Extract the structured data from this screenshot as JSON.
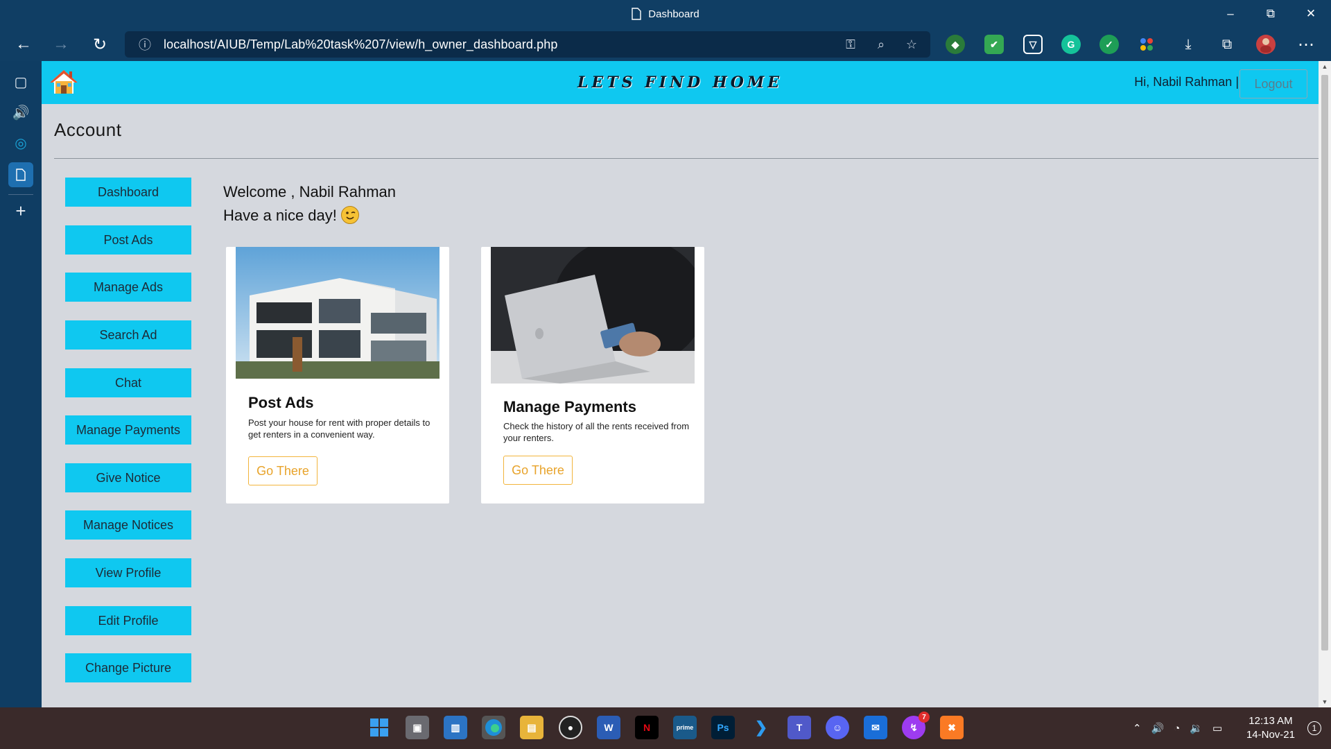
{
  "window": {
    "title": "Dashboard",
    "minimize_icon": "minimize-icon",
    "restore_icon": "restore-icon",
    "close_icon": "close-icon"
  },
  "browser": {
    "url": "localhost/AIUB/Temp/Lab%20task%207/view/h_owner_dashboard.php",
    "buttons": [
      "back",
      "forward",
      "refresh"
    ],
    "extension_icons": [
      "chrome-ext-icon",
      "shield-green-icon",
      "brave-shield-icon",
      "grammarly-icon",
      "check-shield-icon",
      "google-dots-icon"
    ]
  },
  "app": {
    "brand": "LETS FIND HOME",
    "greeting": "Hi, Nabil Rahman |",
    "logout": "Logout",
    "page_title": "Account",
    "accent_color": "#0fc8f0",
    "welcome_line1": "Welcome , Nabil Rahman",
    "welcome_line2": "Have a nice day!",
    "sidebar": [
      {
        "label": "Dashboard"
      },
      {
        "label": "Post Ads"
      },
      {
        "label": "Manage Ads"
      },
      {
        "label": "Search Ad"
      },
      {
        "label": "Chat"
      },
      {
        "label": "Manage Payments"
      },
      {
        "label": "Give Notice"
      },
      {
        "label": "Manage Notices"
      },
      {
        "label": "View Profile"
      },
      {
        "label": "Edit Profile"
      },
      {
        "label": "Change Picture"
      }
    ],
    "cards": [
      {
        "title": "Post Ads",
        "desc": "Post your house for rent with proper details to get renters in a convenient way.",
        "button": "Go There"
      },
      {
        "title": "Manage Payments",
        "desc": "Check the history of all the rents received from your renters.",
        "button": "Go There"
      }
    ]
  },
  "taskbar": {
    "apps": [
      "windows-start-icon",
      "task-view-icon",
      "widgets-icon",
      "edge-icon",
      "file-explorer-icon",
      "obs-icon",
      "word-icon",
      "netflix-icon",
      "prime-video-icon",
      "photoshop-icon",
      "vscode-icon",
      "teams-icon",
      "discord-icon",
      "mail-icon",
      "messenger-icon",
      "xampp-icon"
    ],
    "messenger_badge": "7",
    "time": "12:13 AM",
    "date": "14-Nov-21",
    "notification_count": "1"
  }
}
